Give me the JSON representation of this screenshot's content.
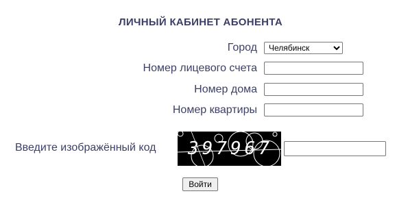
{
  "title": "ЛИЧНЫЙ КАБИНЕТ АБОНЕНТА",
  "form": {
    "city_label": "Город",
    "city_selected": "Челябинск",
    "account_label": "Номер лицевого счета",
    "account_value": "",
    "house_label": "Номер дома",
    "house_value": "",
    "flat_label": "Номер квартиры",
    "flat_value": "",
    "captcha_label": "Введите изображённый код",
    "captcha_text": "397967",
    "captcha_value": "",
    "submit_label": "Войти"
  }
}
